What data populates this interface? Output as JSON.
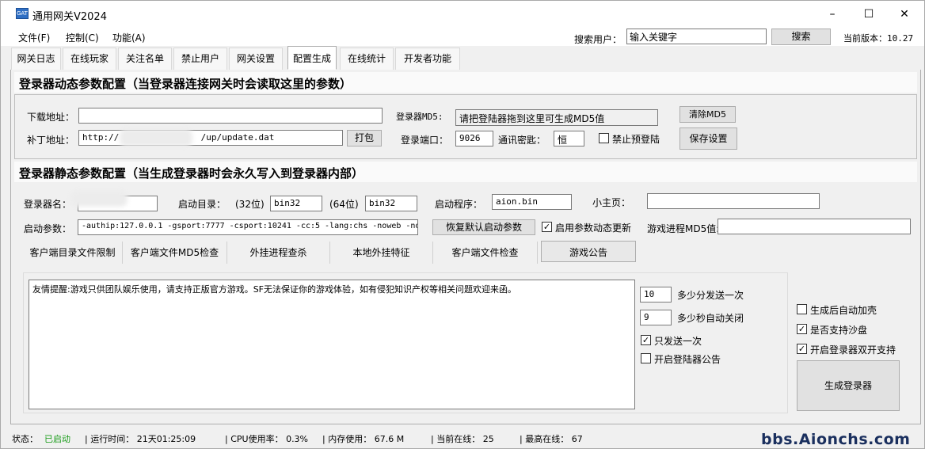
{
  "window": {
    "title": "通用网关V2024",
    "icon_text": "GATE",
    "controls": [
      "–",
      "☐",
      "✕"
    ]
  },
  "menu": {
    "items": [
      "文件(F)",
      "控制(C)",
      "功能(A)"
    ],
    "search_label": "搜索用户：",
    "search_value": "输入关键字",
    "search_button": "搜索",
    "version": "当前版本：10.27"
  },
  "tabs": [
    "网关日志",
    "在线玩家",
    "关注名单",
    "禁止用户",
    "网关设置",
    "配置生成",
    "在线统计",
    "开发者功能"
  ],
  "active_tab": "配置生成",
  "dynamic": {
    "title": "登录器动态参数配置（当登录器连接网关时会读取这里的参数）",
    "download_label": "下载地址：",
    "download_value": "",
    "patch_label": "补丁地址：",
    "patch_prefix": "http://",
    "patch_suffix": "/up/update.dat",
    "pack_button": "打包",
    "md5_label": "登录器MD5:",
    "md5_value": "请把登陆器拖到这里可生成MD5值",
    "clear_md5_button": "清除MD5",
    "port_label": "登录端口：",
    "port_value": "9026",
    "key_label": "通讯密匙：",
    "key_value": "恒",
    "prelogin_label": "禁止预登陆",
    "save_button": "保存设置"
  },
  "static": {
    "title": "登录器静态参数配置（当生成登录器时会永久写入到登录器内部）",
    "name_label": "登录器名：",
    "startdir_label": "启动目录：",
    "bit32_label": "(32位)",
    "bit32_value": "bin32",
    "bit64_label": "(64位)",
    "bit64_value": "bin32",
    "program_label": "启动程序：",
    "program_value": "aion.bin",
    "homepage_label": "小主页：",
    "homepage_value": "",
    "params_label": "启动参数：",
    "params_value": "-authip:127.0.0.1 -gsport:7777 -csport:10241 -cc:5 -lang:chs -noweb -no",
    "restore_button": "恢复默认启动参数",
    "dynamic_update_label": "启用参数动态更新",
    "process_md5_label": "游戏进程MD5值:",
    "process_md5_value": ""
  },
  "subtabs": [
    "客户端目录文件限制",
    "客户端文件MD5检查",
    "外挂进程查杀",
    "本地外挂特征",
    "客户端文件检查",
    "游戏公告"
  ],
  "active_subtab": "游戏公告",
  "notice": {
    "text": "友情提醒:游戏只供团队娱乐使用，请支持正版官方游戏。SF无法保证你的游戏体验，如有侵犯知识产权等相关问题欢迎来函。",
    "interval_value": "10",
    "interval_label": "多少分发送一次",
    "close_value": "9",
    "close_label": "多少秒自动关闭",
    "once_label": "只发送一次",
    "open_notice_label": "开启登陆器公告"
  },
  "options": {
    "auto_shell_label": "生成后自动加壳",
    "sandbox_label": "是否支持沙盘",
    "dual_label": "开启登录器双开支持",
    "generate_button": "生成登录器"
  },
  "status": {
    "state_label": "状态：",
    "state_value": "已启动",
    "runtime": "| 运行时间： 21天01:25:09",
    "cpu": "| CPU使用率： 0.3%",
    "memory": "| 内存使用： 67.6 M",
    "online": "| 当前在线： 25",
    "max_online": "| 最高在线： 67"
  },
  "watermark": "bbs.Aionchs.com",
  "colors": {
    "status_ok": "#1a9c1a",
    "tab_active_bg": "#ffffff",
    "window_bg": "#f0f0f0"
  }
}
